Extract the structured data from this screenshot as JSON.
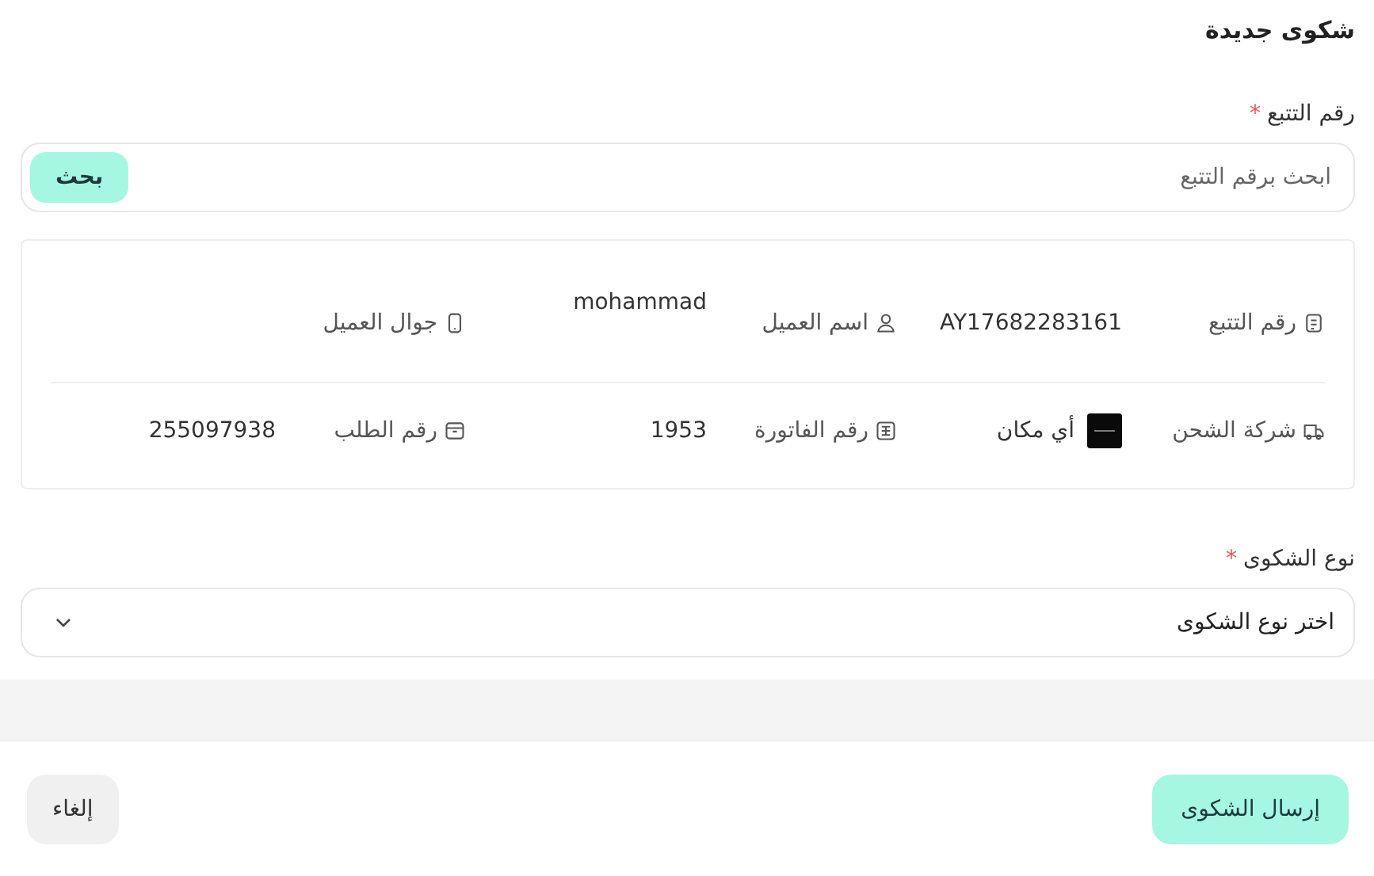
{
  "title": "شكوى جديدة",
  "tracking": {
    "label": "رقم التتبع",
    "required_mark": "*",
    "placeholder": "ابحث برقم التتبع",
    "button": "بحث"
  },
  "details": [
    [
      {
        "label": "رقم التتبع",
        "kind": "document",
        "value": "AY17682283161"
      },
      {
        "label": "اسم العميل",
        "kind": "person",
        "value": "mohammad",
        "raised": true
      },
      {
        "label": "جوال العميل",
        "kind": "phone"
      }
    ],
    [
      {
        "label": "شركة الشحن",
        "kind": "truck",
        "value": "أي مكان",
        "logo": true
      },
      {
        "label": "رقم الفاتورة",
        "kind": "invoice",
        "value": "1953"
      },
      {
        "label": "رقم الطلب",
        "kind": "box",
        "value": "255097938"
      }
    ]
  ],
  "complaint_type": {
    "label": "نوع الشكوى",
    "required_mark": "*",
    "placeholder": "اختر نوع الشكوى"
  },
  "buttons": [
    {
      "label": "إرسال الشكوى",
      "kind": "primary"
    },
    {
      "label": "إلغاء",
      "kind": "secondary"
    }
  ]
}
